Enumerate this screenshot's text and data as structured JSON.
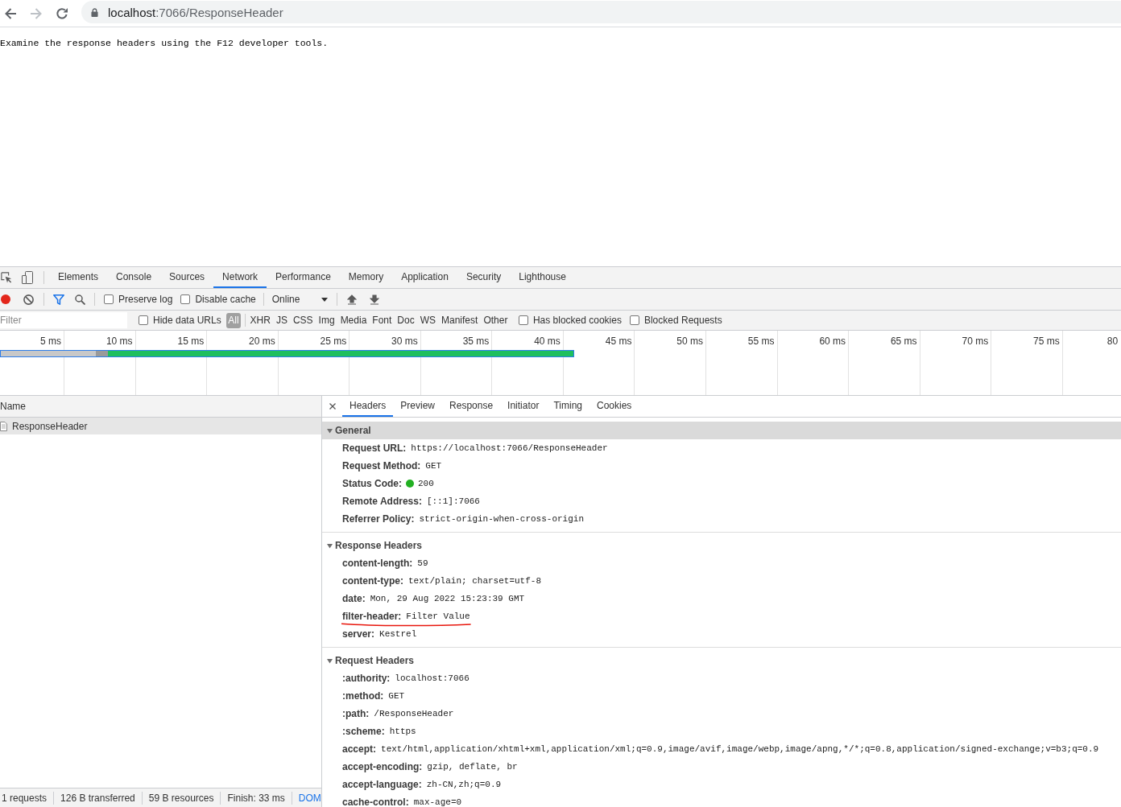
{
  "browser": {
    "url": {
      "host": "localhost",
      "rest": ":7066/ResponseHeader"
    }
  },
  "page": {
    "text": "Examine the response headers using the F12 developer tools."
  },
  "devtools": {
    "tabs": [
      {
        "label": "Elements",
        "selected": false
      },
      {
        "label": "Console",
        "selected": false
      },
      {
        "label": "Sources",
        "selected": false
      },
      {
        "label": "Network",
        "selected": true
      },
      {
        "label": "Performance",
        "selected": false
      },
      {
        "label": "Memory",
        "selected": false
      },
      {
        "label": "Application",
        "selected": false
      },
      {
        "label": "Security",
        "selected": false
      },
      {
        "label": "Lighthouse",
        "selected": false
      }
    ],
    "toolbar": {
      "recording": true,
      "filter_open": true,
      "preserve_log": {
        "label": "Preserve log",
        "checked": false
      },
      "disable_cache": {
        "label": "Disable cache",
        "checked": false
      },
      "throttling": "Online"
    },
    "filter_bar": {
      "placeholder": "Filter",
      "hide_data_urls": {
        "label": "Hide data URLs",
        "checked": false
      },
      "types": [
        {
          "label": "All",
          "selected": true
        },
        {
          "label": "XHR",
          "selected": false
        },
        {
          "label": "JS",
          "selected": false
        },
        {
          "label": "CSS",
          "selected": false
        },
        {
          "label": "Img",
          "selected": false
        },
        {
          "label": "Media",
          "selected": false
        },
        {
          "label": "Font",
          "selected": false
        },
        {
          "label": "Doc",
          "selected": false
        },
        {
          "label": "WS",
          "selected": false
        },
        {
          "label": "Manifest",
          "selected": false
        },
        {
          "label": "Other",
          "selected": false
        }
      ],
      "has_blocked_cookies": {
        "label": "Has blocked cookies",
        "checked": false
      },
      "blocked_requests": {
        "label": "Blocked Requests",
        "checked": false
      }
    },
    "timeline": {
      "ticks": [
        "5 ms",
        "10 ms",
        "15 ms",
        "20 ms",
        "25 ms",
        "30 ms",
        "35 ms",
        "40 ms",
        "45 ms",
        "50 ms",
        "55 ms",
        "60 ms",
        "65 ms",
        "70 ms",
        "75 ms",
        "80"
      ]
    },
    "requests": {
      "column": "Name",
      "rows": [
        {
          "name": "ResponseHeader",
          "selected": true
        }
      ]
    },
    "status_bar": [
      {
        "text": "1 requests",
        "kind": "stat"
      },
      {
        "text": "126 B transferred",
        "kind": "stat"
      },
      {
        "text": "59 B resources",
        "kind": "stat"
      },
      {
        "text": "Finish: 33 ms",
        "kind": "stat"
      },
      {
        "text": "DOM",
        "kind": "link"
      }
    ],
    "detail": {
      "tabs": [
        {
          "label": "Headers",
          "selected": true
        },
        {
          "label": "Preview",
          "selected": false
        },
        {
          "label": "Response",
          "selected": false
        },
        {
          "label": "Initiator",
          "selected": false
        },
        {
          "label": "Timing",
          "selected": false
        },
        {
          "label": "Cookies",
          "selected": false
        }
      ],
      "sections": [
        {
          "title": "General",
          "expanded": true,
          "selected": true,
          "rows": [
            {
              "label": "Request URL:",
              "value": "https://localhost:7066/ResponseHeader",
              "kind": "text",
              "underlined": false
            },
            {
              "label": "Request Method:",
              "value": "GET",
              "kind": "text",
              "underlined": false
            },
            {
              "label": "Status Code:",
              "value": "200",
              "kind": "status",
              "underlined": false
            },
            {
              "label": "Remote Address:",
              "value": "[::1]:7066",
              "kind": "text",
              "underlined": false
            },
            {
              "label": "Referrer Policy:",
              "value": "strict-origin-when-cross-origin",
              "kind": "text",
              "underlined": false
            }
          ]
        },
        {
          "title": "Response Headers",
          "expanded": true,
          "selected": false,
          "rows": [
            {
              "label": "content-length:",
              "value": "59",
              "kind": "text",
              "underlined": false
            },
            {
              "label": "content-type:",
              "value": "text/plain; charset=utf-8",
              "kind": "text",
              "underlined": false
            },
            {
              "label": "date:",
              "value": "Mon, 29 Aug 2022 15:23:39 GMT",
              "kind": "text",
              "underlined": false
            },
            {
              "label": "filter-header:",
              "value": "Filter Value",
              "kind": "text",
              "underlined": true
            },
            {
              "label": "server:",
              "value": "Kestrel",
              "kind": "text",
              "underlined": false
            }
          ]
        },
        {
          "title": "Request Headers",
          "expanded": true,
          "selected": false,
          "rows": [
            {
              "label": ":authority:",
              "value": "localhost:7066",
              "kind": "text",
              "underlined": false
            },
            {
              "label": ":method:",
              "value": "GET",
              "kind": "text",
              "underlined": false
            },
            {
              "label": ":path:",
              "value": "/ResponseHeader",
              "kind": "text",
              "underlined": false
            },
            {
              "label": ":scheme:",
              "value": "https",
              "kind": "text",
              "underlined": false
            },
            {
              "label": "accept:",
              "value": "text/html,application/xhtml+xml,application/xml;q=0.9,image/avif,image/webp,image/apng,*/*;q=0.8,application/signed-exchange;v=b3;q=0.9",
              "kind": "text",
              "underlined": false
            },
            {
              "label": "accept-encoding:",
              "value": "gzip, deflate, br",
              "kind": "text",
              "underlined": false
            },
            {
              "label": "accept-language:",
              "value": "zh-CN,zh;q=0.9",
              "kind": "text",
              "underlined": false
            },
            {
              "label": "cache-control:",
              "value": "max-age=0",
              "kind": "text",
              "underlined": false
            }
          ]
        }
      ]
    }
  }
}
